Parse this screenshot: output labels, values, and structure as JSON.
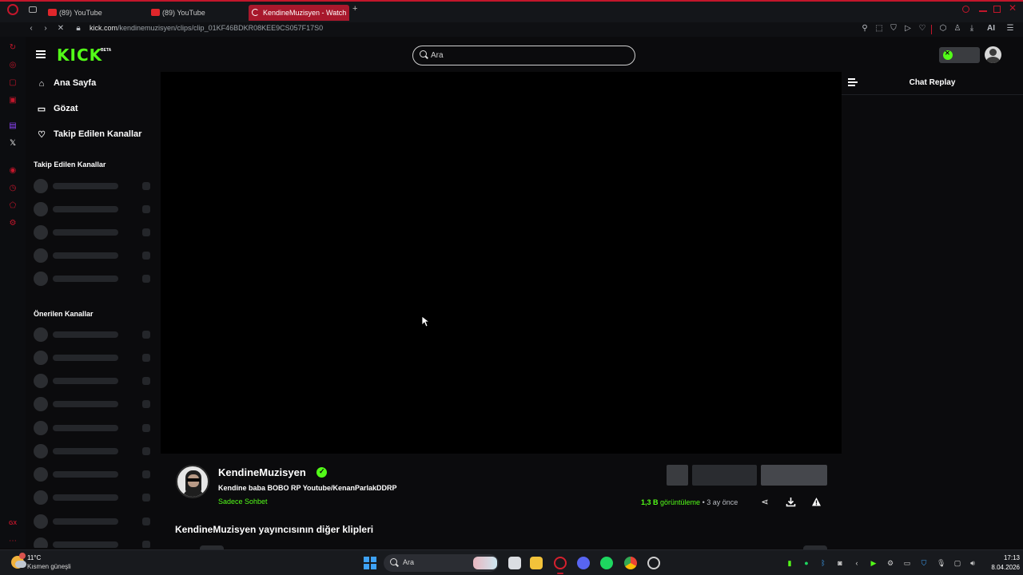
{
  "browser": {
    "tabs": [
      {
        "label": "(89) YouTube",
        "active": false
      },
      {
        "label": "(89) YouTube",
        "active": false
      },
      {
        "label": "KendineMuzisyen - Watch",
        "active": true
      }
    ],
    "url_host": "kick.com",
    "url_path": "/kendinemuzisyen/clips/clip_01KF46BDKR08KEE9CS057F17S0",
    "toolbar_ai_label": "AI"
  },
  "header": {
    "logo": "KICK",
    "logo_badge": "BETA",
    "search_placeholder": "Ara"
  },
  "nav": {
    "items": [
      {
        "label": "Ana Sayfa",
        "icon": "home-icon"
      },
      {
        "label": "Gözat",
        "icon": "browse-icon"
      },
      {
        "label": "Takip Edilen Kanallar",
        "icon": "heart-icon"
      }
    ],
    "followed_title": "Takip Edilen Kanallar",
    "recommended_title": "Önerilen Kanallar"
  },
  "chat": {
    "title": "Chat Replay"
  },
  "clip": {
    "channel_name": "KendineMuzisyen",
    "title": "Kendine baba BOBO RP Youtube/KenanParlakDDRP",
    "category": "Sadece Sohbet",
    "views": "1,3 B",
    "views_label": "görüntüleme",
    "separator": "•",
    "age": "3 ay önce",
    "more_clips_title": "KendineMuzisyen yayıncısının diğer klipleri"
  },
  "taskbar": {
    "weather_temp": "11°C",
    "weather_desc": "Kısmen güneşli",
    "search_text": "Ara",
    "time": "17:13",
    "date": "8.04.2026"
  },
  "colors": {
    "accent": "#53fc18",
    "opera_red": "#c3162b"
  }
}
